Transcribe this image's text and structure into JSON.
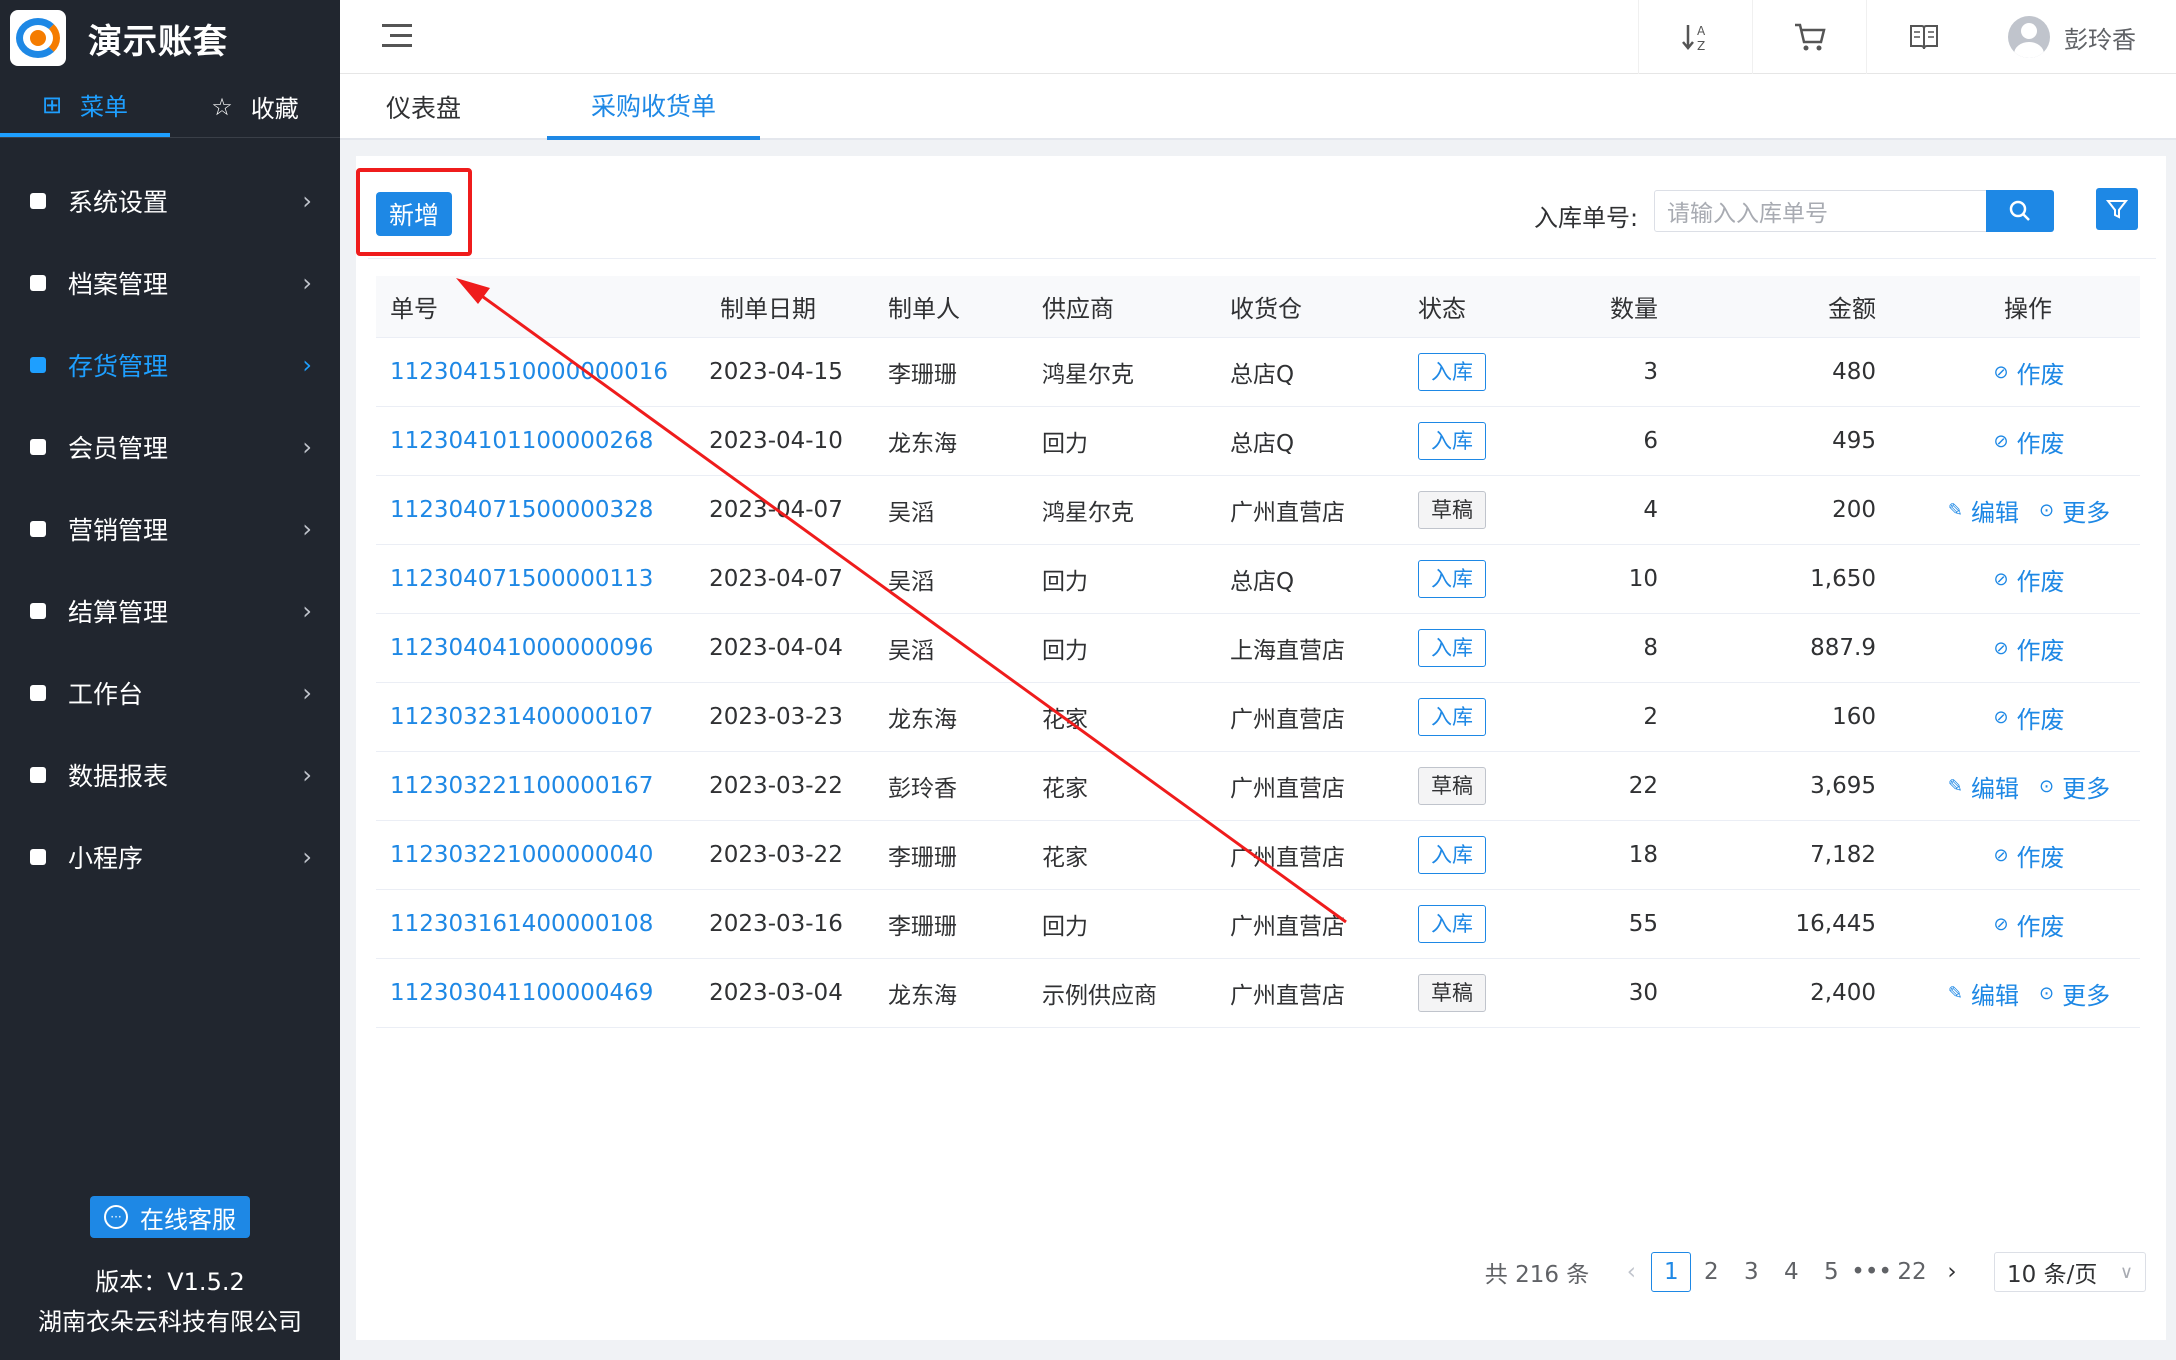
{
  "app": {
    "title": "演示账套"
  },
  "sidebar": {
    "tabs": [
      {
        "label": "菜单",
        "icon": "grid-icon"
      },
      {
        "label": "收藏",
        "icon": "star-icon"
      }
    ],
    "items": [
      {
        "label": "系统设置"
      },
      {
        "label": "档案管理"
      },
      {
        "label": "存货管理"
      },
      {
        "label": "会员管理"
      },
      {
        "label": "营销管理"
      },
      {
        "label": "结算管理"
      },
      {
        "label": "工作台"
      },
      {
        "label": "数据报表"
      },
      {
        "label": "小程序"
      }
    ],
    "service_label": "在线客服",
    "version": "版本：V1.5.2",
    "company": "湖南衣朵云科技有限公司"
  },
  "header": {
    "user_name": "彭玲香"
  },
  "page_tabs": [
    {
      "label": "仪表盘"
    },
    {
      "label": "采购收货单"
    }
  ],
  "toolbar": {
    "add_label": "新增",
    "search_label": "入库单号:",
    "search_placeholder": "请输入入库单号"
  },
  "table": {
    "headers": [
      "单号",
      "制单日期",
      "制单人",
      "供应商",
      "收货仓",
      "状态",
      "数量",
      "金额",
      "操作"
    ],
    "rows": [
      {
        "no": "1123041510000000016",
        "date": "2023-04-15",
        "maker": "李珊珊",
        "supplier": "鸿星尔克",
        "warehouse": "总店Q",
        "status": "入库",
        "qty": "3",
        "amount": "480",
        "ops": [
          "作废"
        ]
      },
      {
        "no": "112304101100000268",
        "date": "2023-04-10",
        "maker": "龙东海",
        "supplier": "回力",
        "warehouse": "总店Q",
        "status": "入库",
        "qty": "6",
        "amount": "495",
        "ops": [
          "作废"
        ]
      },
      {
        "no": "112304071500000328",
        "date": "2023-04-07",
        "maker": "吴滔",
        "supplier": "鸿星尔克",
        "warehouse": "广州直营店",
        "status": "草稿",
        "qty": "4",
        "amount": "200",
        "ops": [
          "编辑",
          "更多"
        ]
      },
      {
        "no": "112304071500000113",
        "date": "2023-04-07",
        "maker": "吴滔",
        "supplier": "回力",
        "warehouse": "总店Q",
        "status": "入库",
        "qty": "10",
        "amount": "1,650",
        "ops": [
          "作废"
        ]
      },
      {
        "no": "112304041000000096",
        "date": "2023-04-04",
        "maker": "吴滔",
        "supplier": "回力",
        "warehouse": "上海直营店",
        "status": "入库",
        "qty": "8",
        "amount": "887.9",
        "ops": [
          "作废"
        ]
      },
      {
        "no": "112303231400000107",
        "date": "2023-03-23",
        "maker": "龙东海",
        "supplier": "花家",
        "warehouse": "广州直营店",
        "status": "入库",
        "qty": "2",
        "amount": "160",
        "ops": [
          "作废"
        ]
      },
      {
        "no": "112303221100000167",
        "date": "2023-03-22",
        "maker": "彭玲香",
        "supplier": "花家",
        "warehouse": "广州直营店",
        "status": "草稿",
        "qty": "22",
        "amount": "3,695",
        "ops": [
          "编辑",
          "更多"
        ]
      },
      {
        "no": "112303221000000040",
        "date": "2023-03-22",
        "maker": "李珊珊",
        "supplier": "花家",
        "warehouse": "广州直营店",
        "status": "入库",
        "qty": "18",
        "amount": "7,182",
        "ops": [
          "作废"
        ]
      },
      {
        "no": "112303161400000108",
        "date": "2023-03-16",
        "maker": "李珊珊",
        "supplier": "回力",
        "warehouse": "广州直营店",
        "status": "入库",
        "qty": "55",
        "amount": "16,445",
        "ops": [
          "作废"
        ]
      },
      {
        "no": "112303041100000469",
        "date": "2023-03-04",
        "maker": "龙东海",
        "supplier": "示例供应商",
        "warehouse": "广州直营店",
        "status": "草稿",
        "qty": "30",
        "amount": "2,400",
        "ops": [
          "编辑",
          "更多"
        ]
      }
    ]
  },
  "pagination": {
    "total": "共 216 条",
    "pages": [
      "1",
      "2",
      "3",
      "4",
      "5"
    ],
    "ellipsis": "•••",
    "last": "22",
    "current": "1",
    "page_size": "10 条/页"
  },
  "colors": {
    "accent": "#1e88e5",
    "sidebar_bg": "#21262f",
    "annotation": "#ef1c1c"
  }
}
